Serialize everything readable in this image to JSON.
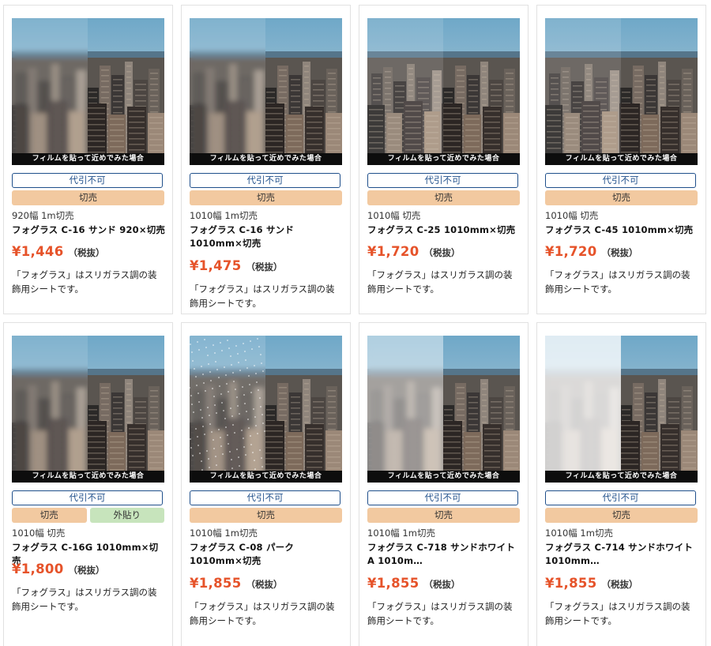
{
  "caption": "フィルムを貼って近めでみた場合",
  "substitute_label": "代引不可",
  "products": [
    {
      "meta": "920幅 1m切売",
      "name": "フォグラス C-16 サンド 920×切売",
      "price": "¥1,446",
      "tax": "（税抜）",
      "desc": "「フォグラス」はスリガラス調の装飾用シートです。",
      "tags": [
        "切売"
      ],
      "filter": "blur"
    },
    {
      "meta": "1010幅 1m切売",
      "name": "フォグラス C-16 サンド 1010mm×切売",
      "price": "¥1,475",
      "tax": "（税抜）",
      "desc": "「フォグラス」はスリガラス調の装飾用シートです。",
      "tags": [
        "切売"
      ],
      "filter": "blur"
    },
    {
      "meta": "1010幅 切売",
      "name": "フォグラス C-25 1010mm×切売",
      "price": "¥1,720",
      "tax": "（税抜）",
      "desc": "「フォグラス」はスリガラス調の装飾用シートです。",
      "tags": [
        "切売"
      ],
      "filter": "tint"
    },
    {
      "meta": "1010幅 切売",
      "name": "フォグラス C-45 1010mm×切売",
      "price": "¥1,720",
      "tax": "（税抜）",
      "desc": "「フォグラス」はスリガラス調の装飾用シートです。",
      "tags": [
        "切売"
      ],
      "filter": "tint"
    },
    {
      "meta": "1010幅 切売",
      "name": "フォグラス C-16G 1010mm×切売",
      "price": "¥1,800",
      "tax": "（税抜）",
      "desc": "「フォグラス」はスリガラス調の装飾用シートです。",
      "tags": [
        "切売",
        "外貼り"
      ],
      "filter": "blur"
    },
    {
      "meta": "1010幅 1m切売",
      "name": "フォグラス C-08 パーク 1010mm×切売",
      "price": "¥1,855",
      "tax": "（税抜）",
      "desc": "「フォグラス」はスリガラス調の装飾用シートです。",
      "tags": [
        "切売"
      ],
      "filter": "speckle"
    },
    {
      "meta": "1010幅 1m切売",
      "name": "フォグラス C-718 サンドホワイトA 1010m…",
      "price": "¥1,855",
      "tax": "（税抜）",
      "desc": "「フォグラス」はスリガラス調の装飾用シートです。",
      "tags": [
        "切売"
      ],
      "filter": "white"
    },
    {
      "meta": "1010幅 1m切売",
      "name": "フォグラス C-714 サンドホワイト 1010mm…",
      "price": "¥1,855",
      "tax": "（税抜）",
      "desc": "「フォグラス」はスリガラス調の装飾用シートです。",
      "tags": [
        "切売"
      ],
      "filter": "whiter"
    }
  ],
  "colors": {
    "price": "#e6532a",
    "badge_border": "#1f4f8b",
    "tag_cut": "#f2c9a0",
    "tag_out": "#c7e4bc"
  }
}
